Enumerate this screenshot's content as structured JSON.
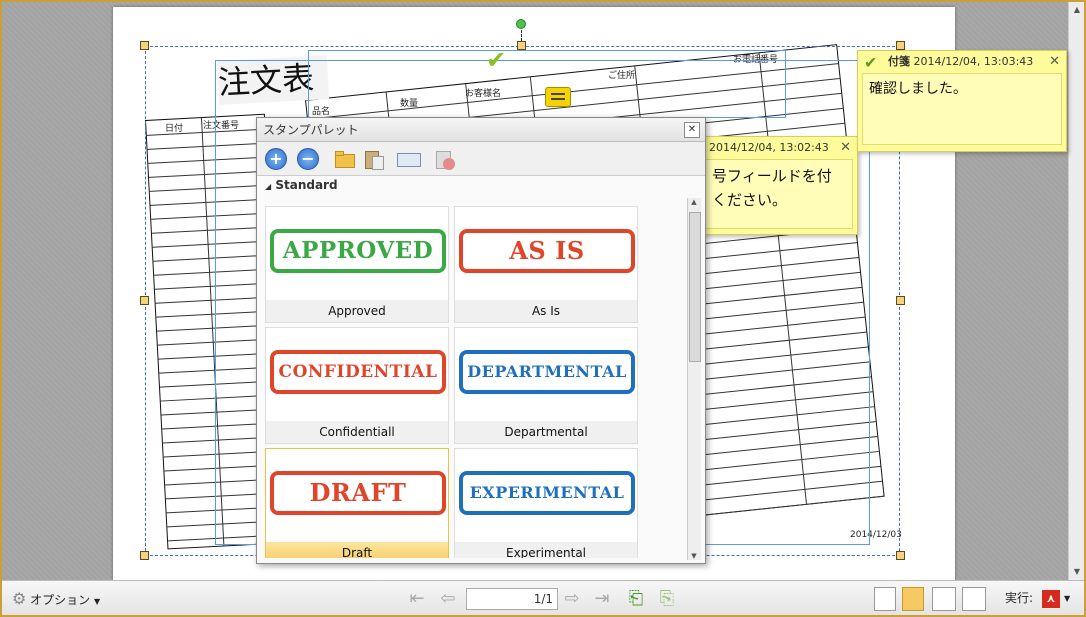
{
  "form": {
    "title": "注文表",
    "left_headers": [
      "日付",
      "注文番号"
    ],
    "top_headers": [
      "品名",
      "数量",
      "お客様名",
      "ご住所",
      "お電話番号"
    ],
    "date": "2014/12/03"
  },
  "notes": [
    {
      "title": "付箋",
      "timestamp": "2014/12/04, 13:03:43",
      "body": "確認しました。"
    },
    {
      "timestamp": "2014/12/04, 13:02:43",
      "body_line1": "号フィールドを付",
      "body_line2": "ください。"
    }
  ],
  "palette": {
    "title": "スタンプパレット",
    "close_glyph": "✕",
    "section": "Standard",
    "stamps": [
      {
        "text": "APPROVED",
        "caption": "Approved",
        "color": "#3aa845"
      },
      {
        "text": "AS IS",
        "caption": "As Is",
        "color": "#e0452a"
      },
      {
        "text": "CONFIDENTIAL",
        "caption": "Confidentiall",
        "color": "#e0452a"
      },
      {
        "text": "DEPARTMENTAL",
        "caption": "Departmental",
        "color": "#1e6fbf"
      },
      {
        "text": "DRAFT",
        "caption": "Draft",
        "color": "#e0452a"
      },
      {
        "text": "EXPERIMENTAL",
        "caption": "Experimental",
        "color": "#1e6fbf"
      }
    ]
  },
  "bottombar": {
    "options_label": "オプション",
    "page_value": "1/1",
    "execute_label": "実行:"
  }
}
